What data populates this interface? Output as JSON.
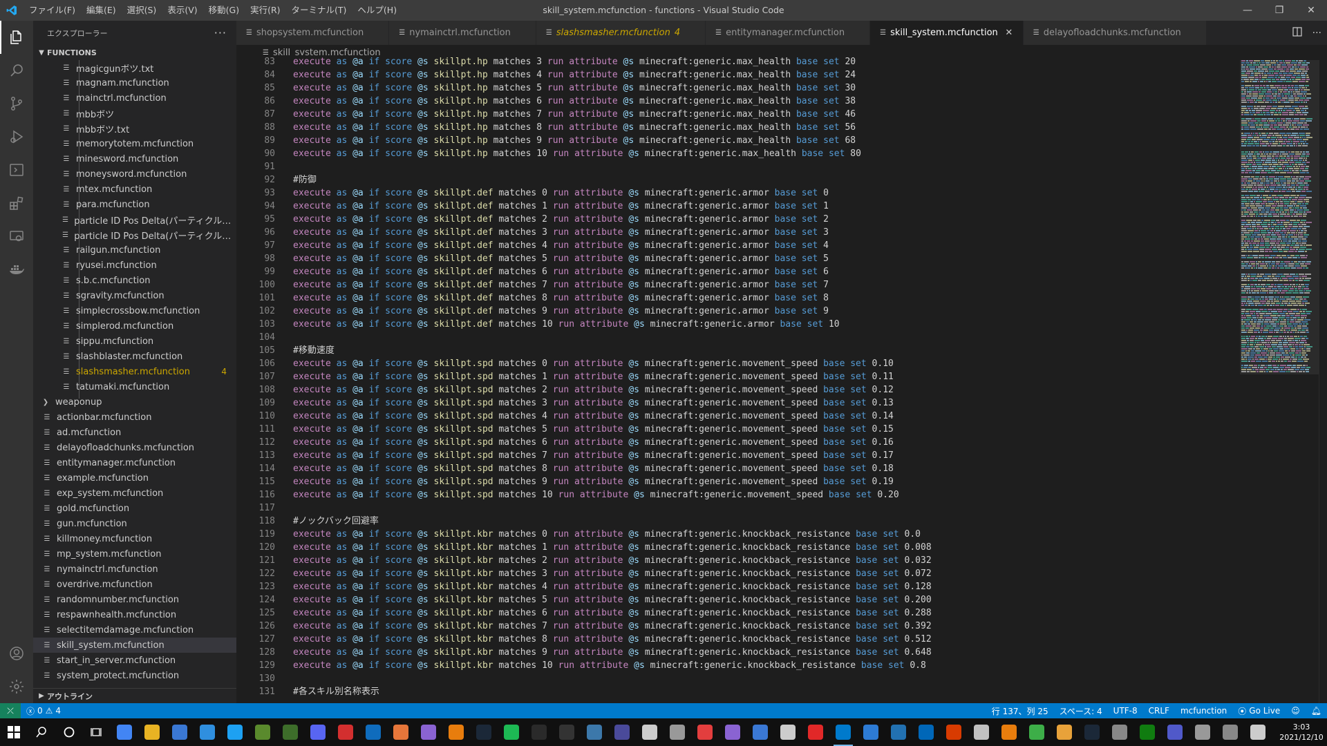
{
  "window": {
    "title": "skill_system.mcfunction - functions - Visual Studio Code",
    "controls": [
      "—",
      "❐",
      "✕"
    ]
  },
  "menu": [
    "ファイル(F)",
    "編集(E)",
    "選択(S)",
    "表示(V)",
    "移動(G)",
    "実行(R)",
    "ターミナル(T)",
    "ヘルプ(H)"
  ],
  "sidebar": {
    "title": "エクスプローラー",
    "more": "···",
    "folder": "FUNCTIONS",
    "outline": "アウトライン",
    "items": [
      {
        "name": "magicgunボツ.txt",
        "depth": 1
      },
      {
        "name": "magnam.mcfunction",
        "depth": 1
      },
      {
        "name": "mainctrl.mcfunction",
        "depth": 1
      },
      {
        "name": "mbbボツ",
        "depth": 1
      },
      {
        "name": "mbbボツ.txt",
        "depth": 1
      },
      {
        "name": "memorytotem.mcfunction",
        "depth": 1
      },
      {
        "name": "minesword.mcfunction",
        "depth": 1
      },
      {
        "name": "moneysword.mcfunction",
        "depth": 1
      },
      {
        "name": "mtex.mcfunction",
        "depth": 1
      },
      {
        "name": "para.mcfunction",
        "depth": 1
      },
      {
        "name": "particle ID Pos Delta(パーティクル範囲)　散...",
        "depth": 1
      },
      {
        "name": "particle ID Pos Delta(パーティクル範囲)　散...",
        "depth": 1
      },
      {
        "name": "railgun.mcfunction",
        "depth": 1
      },
      {
        "name": "ryusei.mcfunction",
        "depth": 1
      },
      {
        "name": "s.b.c.mcfunction",
        "depth": 1
      },
      {
        "name": "sgravity.mcfunction",
        "depth": 1
      },
      {
        "name": "simplecrossbow.mcfunction",
        "depth": 1
      },
      {
        "name": "simplerod.mcfunction",
        "depth": 1
      },
      {
        "name": "sippu.mcfunction",
        "depth": 1
      },
      {
        "name": "slashblaster.mcfunction",
        "depth": 1
      },
      {
        "name": "slashsmasher.mcfunction",
        "depth": 1,
        "modified": true,
        "badge": "4"
      },
      {
        "name": "tatumaki.mcfunction",
        "depth": 1
      },
      {
        "name": "weaponup",
        "depth": 0,
        "folder": true
      },
      {
        "name": "actionbar.mcfunction",
        "depth": 0
      },
      {
        "name": "ad.mcfunction",
        "depth": 0
      },
      {
        "name": "delayofloadchunks.mcfunction",
        "depth": 0
      },
      {
        "name": "entitymanager.mcfunction",
        "depth": 0
      },
      {
        "name": "example.mcfunction",
        "depth": 0
      },
      {
        "name": "exp_system.mcfunction",
        "depth": 0
      },
      {
        "name": "gold.mcfunction",
        "depth": 0
      },
      {
        "name": "gun.mcfunction",
        "depth": 0
      },
      {
        "name": "killmoney.mcfunction",
        "depth": 0
      },
      {
        "name": "mp_system.mcfunction",
        "depth": 0
      },
      {
        "name": "nymainctrl.mcfunction",
        "depth": 0
      },
      {
        "name": "overdrive.mcfunction",
        "depth": 0
      },
      {
        "name": "randomnumber.mcfunction",
        "depth": 0
      },
      {
        "name": "respawnhealth.mcfunction",
        "depth": 0
      },
      {
        "name": "selectitemdamage.mcfunction",
        "depth": 0
      },
      {
        "name": "skill_system.mcfunction",
        "depth": 0,
        "selected": true
      },
      {
        "name": "start_in_server.mcfunction",
        "depth": 0
      },
      {
        "name": "system_protect.mcfunction",
        "depth": 0
      }
    ]
  },
  "tabs": [
    {
      "label": "shopsystem.mcfunction"
    },
    {
      "label": "nymainctrl.mcfunction"
    },
    {
      "label": "slashsmasher.mcfunction",
      "modified": true,
      "badge": "4"
    },
    {
      "label": "entitymanager.mcfunction"
    },
    {
      "label": "skill_system.mcfunction",
      "active": true,
      "close": "✕"
    },
    {
      "label": "delayofloadchunks.mcfunction"
    }
  ],
  "breadcrumb": "skill_system.mcfunction",
  "editor": {
    "lines": [
      {
        "n": "83",
        "stat": "skillpt.hp",
        "m": "3",
        "attr": "minecraft:generic.max_health",
        "val": "20"
      },
      {
        "n": "84",
        "stat": "skillpt.hp",
        "m": "4",
        "attr": "minecraft:generic.max_health",
        "val": "24"
      },
      {
        "n": "85",
        "stat": "skillpt.hp",
        "m": "5",
        "attr": "minecraft:generic.max_health",
        "val": "30"
      },
      {
        "n": "86",
        "stat": "skillpt.hp",
        "m": "6",
        "attr": "minecraft:generic.max_health",
        "val": "38"
      },
      {
        "n": "87",
        "stat": "skillpt.hp",
        "m": "7",
        "attr": "minecraft:generic.max_health",
        "val": "46"
      },
      {
        "n": "88",
        "stat": "skillpt.hp",
        "m": "8",
        "attr": "minecraft:generic.max_health",
        "val": "56"
      },
      {
        "n": "89",
        "stat": "skillpt.hp",
        "m": "9",
        "attr": "minecraft:generic.max_health",
        "val": "68"
      },
      {
        "n": "90",
        "stat": "skillpt.hp",
        "m": "10",
        "attr": "minecraft:generic.max_health",
        "val": "80"
      },
      {
        "n": "91",
        "text": ""
      },
      {
        "n": "92",
        "text": "#防御"
      },
      {
        "n": "93",
        "stat": "skillpt.def",
        "m": "0",
        "attr": "minecraft:generic.armor",
        "val": "0"
      },
      {
        "n": "94",
        "stat": "skillpt.def",
        "m": "1",
        "attr": "minecraft:generic.armor",
        "val": "1"
      },
      {
        "n": "95",
        "stat": "skillpt.def",
        "m": "2",
        "attr": "minecraft:generic.armor",
        "val": "2"
      },
      {
        "n": "96",
        "stat": "skillpt.def",
        "m": "3",
        "attr": "minecraft:generic.armor",
        "val": "3"
      },
      {
        "n": "97",
        "stat": "skillpt.def",
        "m": "4",
        "attr": "minecraft:generic.armor",
        "val": "4"
      },
      {
        "n": "98",
        "stat": "skillpt.def",
        "m": "5",
        "attr": "minecraft:generic.armor",
        "val": "5"
      },
      {
        "n": "99",
        "stat": "skillpt.def",
        "m": "6",
        "attr": "minecraft:generic.armor",
        "val": "6"
      },
      {
        "n": "100",
        "stat": "skillpt.def",
        "m": "7",
        "attr": "minecraft:generic.armor",
        "val": "7"
      },
      {
        "n": "101",
        "stat": "skillpt.def",
        "m": "8",
        "attr": "minecraft:generic.armor",
        "val": "8"
      },
      {
        "n": "102",
        "stat": "skillpt.def",
        "m": "9",
        "attr": "minecraft:generic.armor",
        "val": "9"
      },
      {
        "n": "103",
        "stat": "skillpt.def",
        "m": "10",
        "attr": "minecraft:generic.armor",
        "val": "10"
      },
      {
        "n": "104",
        "text": ""
      },
      {
        "n": "105",
        "text": "#移動速度"
      },
      {
        "n": "106",
        "stat": "skillpt.spd",
        "m": "0",
        "attr": "minecraft:generic.movement_speed",
        "val": "0.10"
      },
      {
        "n": "107",
        "stat": "skillpt.spd",
        "m": "1",
        "attr": "minecraft:generic.movement_speed",
        "val": "0.11"
      },
      {
        "n": "108",
        "stat": "skillpt.spd",
        "m": "2",
        "attr": "minecraft:generic.movement_speed",
        "val": "0.12"
      },
      {
        "n": "109",
        "stat": "skillpt.spd",
        "m": "3",
        "attr": "minecraft:generic.movement_speed",
        "val": "0.13"
      },
      {
        "n": "110",
        "stat": "skillpt.spd",
        "m": "4",
        "attr": "minecraft:generic.movement_speed",
        "val": "0.14"
      },
      {
        "n": "111",
        "stat": "skillpt.spd",
        "m": "5",
        "attr": "minecraft:generic.movement_speed",
        "val": "0.15"
      },
      {
        "n": "112",
        "stat": "skillpt.spd",
        "m": "6",
        "attr": "minecraft:generic.movement_speed",
        "val": "0.16"
      },
      {
        "n": "113",
        "stat": "skillpt.spd",
        "m": "7",
        "attr": "minecraft:generic.movement_speed",
        "val": "0.17"
      },
      {
        "n": "114",
        "stat": "skillpt.spd",
        "m": "8",
        "attr": "minecraft:generic.movement_speed",
        "val": "0.18"
      },
      {
        "n": "115",
        "stat": "skillpt.spd",
        "m": "9",
        "attr": "minecraft:generic.movement_speed",
        "val": "0.19"
      },
      {
        "n": "116",
        "stat": "skillpt.spd",
        "m": "10",
        "attr": "minecraft:generic.movement_speed",
        "val": "0.20"
      },
      {
        "n": "117",
        "text": ""
      },
      {
        "n": "118",
        "text": "#ノックバック回避率"
      },
      {
        "n": "119",
        "stat": "skillpt.kbr",
        "m": "0",
        "attr": "minecraft:generic.knockback_resistance",
        "val": "0.0"
      },
      {
        "n": "120",
        "stat": "skillpt.kbr",
        "m": "1",
        "attr": "minecraft:generic.knockback_resistance",
        "val": "0.008"
      },
      {
        "n": "121",
        "stat": "skillpt.kbr",
        "m": "2",
        "attr": "minecraft:generic.knockback_resistance",
        "val": "0.032"
      },
      {
        "n": "122",
        "stat": "skillpt.kbr",
        "m": "3",
        "attr": "minecraft:generic.knockback_resistance",
        "val": "0.072"
      },
      {
        "n": "123",
        "stat": "skillpt.kbr",
        "m": "4",
        "attr": "minecraft:generic.knockback_resistance",
        "val": "0.128"
      },
      {
        "n": "124",
        "stat": "skillpt.kbr",
        "m": "5",
        "attr": "minecraft:generic.knockback_resistance",
        "val": "0.200"
      },
      {
        "n": "125",
        "stat": "skillpt.kbr",
        "m": "6",
        "attr": "minecraft:generic.knockback_resistance",
        "val": "0.288"
      },
      {
        "n": "126",
        "stat": "skillpt.kbr",
        "m": "7",
        "attr": "minecraft:generic.knockback_resistance",
        "val": "0.392"
      },
      {
        "n": "127",
        "stat": "skillpt.kbr",
        "m": "8",
        "attr": "minecraft:generic.knockback_resistance",
        "val": "0.512"
      },
      {
        "n": "128",
        "stat": "skillpt.kbr",
        "m": "9",
        "attr": "minecraft:generic.knockback_resistance",
        "val": "0.648"
      },
      {
        "n": "129",
        "stat": "skillpt.kbr",
        "m": "10",
        "attr": "minecraft:generic.knockback_resistance",
        "val": "0.8"
      },
      {
        "n": "130",
        "text": ""
      },
      {
        "n": "131",
        "text": "#各スキル別名称表示"
      }
    ]
  },
  "statusbar": {
    "remote": "⤫",
    "errors": "0",
    "warnings": "4",
    "position": "行 137、列 25",
    "spaces": "スペース: 4",
    "encoding": "UTF-8",
    "eol": "CRLF",
    "language": "mcfunction",
    "golive": "Go Live"
  },
  "taskbar": {
    "time": "3:03",
    "date": "2021/12/10",
    "apps": [
      "chrome-icon",
      "file-explorer-icon",
      "store-icon",
      "edge-icon",
      "twitter-icon",
      "minecraft-icon",
      "game-icon",
      "discord-icon",
      "autodesk-icon",
      "outlook-icon",
      "git-icon",
      "github-icon",
      "blender-icon",
      "steam-icon",
      "spotify-icon",
      "epic-games-icon",
      "unreal-icon",
      "app-icon",
      "app-icon",
      "app-icon",
      "lock-icon",
      "ea-icon",
      "github-desktop-icon",
      "app-icon",
      "app-icon",
      "opera-icon",
      "vscode-icon",
      "app-icon",
      "wordpress-icon",
      "app-icon",
      "app-icon",
      "app-icon",
      "app-icon",
      "app-icon",
      "app-icon",
      "steam-icon",
      "app-icon",
      "xbox-icon",
      "teams-icon",
      "settings-icon",
      "app-icon",
      "pen-icon"
    ],
    "app_colors": [
      "#4285f4",
      "#e8b323",
      "#3a78d4",
      "#2f8fdf",
      "#1da1f2",
      "#5a8a2d",
      "#3d6d2a",
      "#5865f2",
      "#d32f2f",
      "#0f6cbd",
      "#e6763a",
      "#8a63d2",
      "#e87d0d",
      "#1b2838",
      "#1db954",
      "#2a2a2a",
      "#333333",
      "#3c78aa",
      "#4a4a9a",
      "#cccccc",
      "#999999",
      "#e33e3e",
      "#8a63d2",
      "#3a78d4",
      "#cccccc",
      "#e12828",
      "#007acc",
      "#2d7bd4",
      "#2271b1",
      "#0067b8",
      "#d83b01",
      "#c1c1c1",
      "#e87d0d",
      "#3dae48",
      "#e8a23a",
      "#1b2838",
      "#888888",
      "#107c10",
      "#5059c9",
      "#999999",
      "#888888",
      "#cccccc"
    ]
  }
}
